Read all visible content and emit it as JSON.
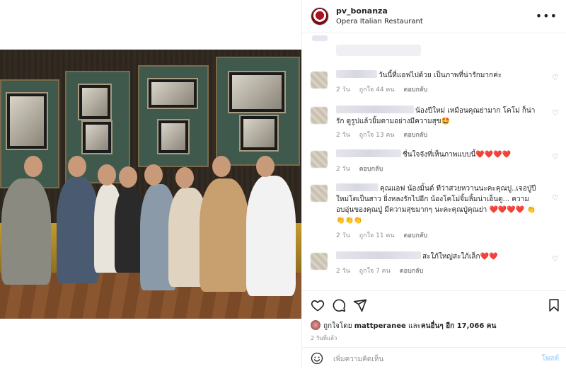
{
  "post": {
    "username": "pv_bonanza",
    "location": "Opera Italian Restaurant",
    "more_label": "•••"
  },
  "comments": [
    {
      "text": "วันนี้ที่แอฟไปด้วย เป็นภาพที่น่ารักมากค่ะ",
      "time": "2 วัน",
      "likes": "ถูกใจ 44 คน",
      "reply": "ตอบกลับ"
    },
    {
      "text": "น้องปีใหม่ เหมือนคุณย่ามาก โคโม่ ก็น่ารัก ดูรูปแล้วยิ้มตามอย่างมีความสุข🤩",
      "time": "2 วัน",
      "likes": "ถูกใจ 13 คน",
      "reply": "ตอบกลับ"
    },
    {
      "text": "ชื่นใจจังที่เห็นภาพแบบนี้❤️❤️❤️❤️",
      "time": "2 วัน",
      "likes": "",
      "reply": "ตอบกลับ"
    },
    {
      "text": "คุณแอฟ น้องมิ้นต์ ทีว่าสวยหวานนะคะคุณปู..เจอปู่ปีใหม่โตเป็นสาว ยิ่งหลงรักไปอีก น้องโคโม่จิ้มลิ้มน่าเอ็นดู... ความอบอุ่นของคุณปู่ มีความสุขมากๆ นะคะคุณปู่คุณย่า ❤️❤️❤️❤️ 👏👏👏👏",
      "time": "2 วัน",
      "likes": "ถูกใจ 11 คน",
      "reply": "ตอบกลับ"
    },
    {
      "text": "สะใภ้ใหญ่สะใภ้เล็ก❤️❤️",
      "time": "2 วัน",
      "likes": "ถูกใจ 7 คน",
      "reply": "ตอบกลับ"
    }
  ],
  "likes_summary": {
    "prefix": "ถูกใจโดย",
    "user": "mattperanee",
    "middle": "และ",
    "others": "คนอื่นๆ อีก 17,066 คน"
  },
  "post_time": "2 วันที่แล้ว",
  "comment_box": {
    "placeholder": "เพิ่มความคิดเห็น",
    "post_label": "โพสต์"
  },
  "icons": {
    "more": "more-horizontal-icon",
    "like": "heart-icon",
    "comment": "comment-bubble-icon",
    "share": "paper-plane-icon",
    "save": "bookmark-icon",
    "emoji": "emoji-smile-icon"
  },
  "colors": {
    "post_button_disabled": "#b3dbff",
    "meta_text": "#8e8e8e",
    "divider": "#efefef"
  }
}
